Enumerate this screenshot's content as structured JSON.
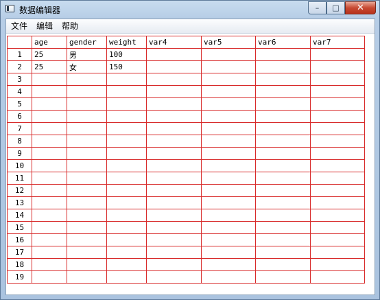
{
  "window": {
    "title": "数据编辑器",
    "controls": {
      "minimize": "–",
      "maximize": "□",
      "close": "✕"
    }
  },
  "menubar": {
    "items": [
      "文件",
      "编辑",
      "帮助"
    ]
  },
  "grid": {
    "columns": [
      "age",
      "gender",
      "weight",
      "var4",
      "var5",
      "var6",
      "var7"
    ],
    "rows": [
      {
        "n": "1",
        "cells": [
          "25",
          "男",
          "100",
          "",
          "",
          "",
          ""
        ]
      },
      {
        "n": "2",
        "cells": [
          "25",
          "女",
          "150",
          "",
          "",
          "",
          ""
        ]
      },
      {
        "n": "3",
        "cells": [
          "",
          "",
          "",
          "",
          "",
          "",
          ""
        ]
      },
      {
        "n": "4",
        "cells": [
          "",
          "",
          "",
          "",
          "",
          "",
          ""
        ]
      },
      {
        "n": "5",
        "cells": [
          "",
          "",
          "",
          "",
          "",
          "",
          ""
        ]
      },
      {
        "n": "6",
        "cells": [
          "",
          "",
          "",
          "",
          "",
          "",
          ""
        ]
      },
      {
        "n": "7",
        "cells": [
          "",
          "",
          "",
          "",
          "",
          "",
          ""
        ]
      },
      {
        "n": "8",
        "cells": [
          "",
          "",
          "",
          "",
          "",
          "",
          ""
        ]
      },
      {
        "n": "9",
        "cells": [
          "",
          "",
          "",
          "",
          "",
          "",
          ""
        ]
      },
      {
        "n": "10",
        "cells": [
          "",
          "",
          "",
          "",
          "",
          "",
          ""
        ]
      },
      {
        "n": "11",
        "cells": [
          "",
          "",
          "",
          "",
          "",
          "",
          ""
        ]
      },
      {
        "n": "12",
        "cells": [
          "",
          "",
          "",
          "",
          "",
          "",
          ""
        ]
      },
      {
        "n": "13",
        "cells": [
          "",
          "",
          "",
          "",
          "",
          "",
          ""
        ]
      },
      {
        "n": "14",
        "cells": [
          "",
          "",
          "",
          "",
          "",
          "",
          ""
        ]
      },
      {
        "n": "15",
        "cells": [
          "",
          "",
          "",
          "",
          "",
          "",
          ""
        ]
      },
      {
        "n": "16",
        "cells": [
          "",
          "",
          "",
          "",
          "",
          "",
          ""
        ]
      },
      {
        "n": "17",
        "cells": [
          "",
          "",
          "",
          "",
          "",
          "",
          ""
        ]
      },
      {
        "n": "18",
        "cells": [
          "",
          "",
          "",
          "",
          "",
          "",
          ""
        ]
      },
      {
        "n": "19",
        "cells": [
          "",
          "",
          "",
          "",
          "",
          "",
          ""
        ]
      }
    ]
  },
  "colors": {
    "grid_line": "#d82a2a",
    "close_button": "#c74a32"
  }
}
